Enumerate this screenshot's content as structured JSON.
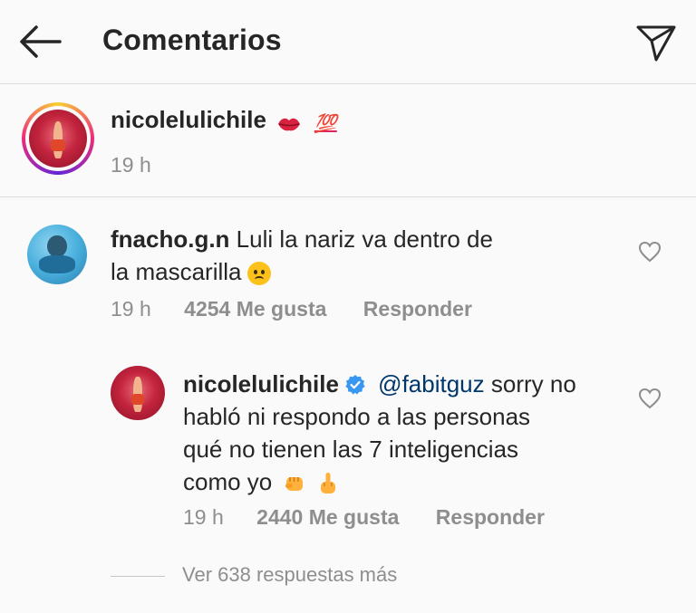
{
  "header": {
    "title": "Comentarios",
    "back_icon": "arrow-left-icon",
    "share_icon": "paper-plane-icon"
  },
  "caption": {
    "username": "nicolelulichile",
    "emoji_100": "💯",
    "time": "19 h"
  },
  "comments": [
    {
      "username": "fnacho.g.n",
      "text_line1": "Luli la nariz va dentro de",
      "text_line2": "la mascarilla",
      "time": "19 h",
      "likes": "4254 Me gusta",
      "reply": "Responder"
    }
  ],
  "reply": {
    "username": "nicolelulichile",
    "mention": "@fabitguz",
    "text_after_mention": " sorry no",
    "text_line2": "habló ni respondo a las personas",
    "text_line3": "qué no tienen las 7 inteligencias",
    "text_line4": "como yo",
    "time": "19 h",
    "likes": "2440 Me gusta",
    "reply": "Responder"
  },
  "view_more": "Ver 638 respuestas más",
  "colors": {
    "text": "#262626",
    "meta": "#8e8e8e",
    "mention": "#00376b",
    "verified": "#3897f0",
    "background": "#fafafa"
  }
}
